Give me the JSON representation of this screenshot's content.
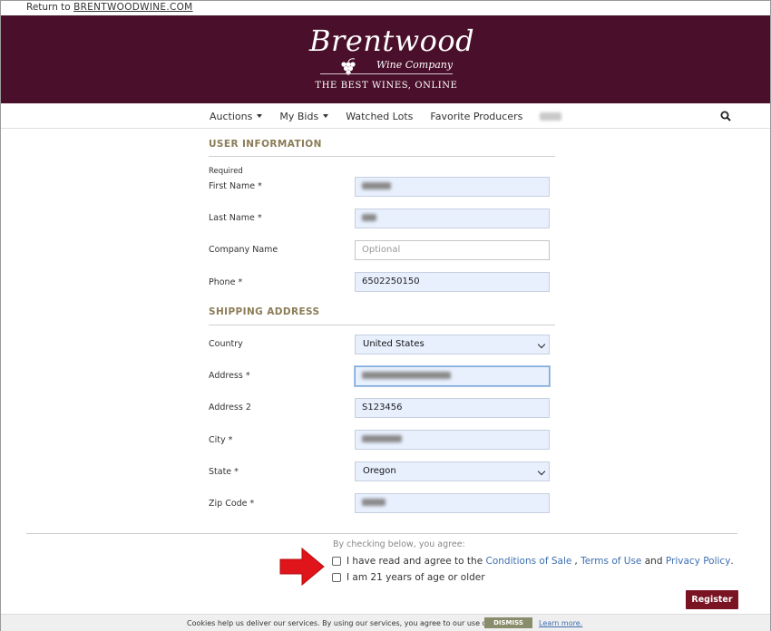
{
  "topbar": {
    "prefix": "Return to",
    "link": "BRENTWOODWINE.COM"
  },
  "logo": {
    "name": "Brentwood",
    "sub": "Wine Company",
    "tagline": "The Best Wines, Online"
  },
  "nav": {
    "items": [
      {
        "label": "Auctions",
        "dropdown": true
      },
      {
        "label": "My Bids",
        "dropdown": true
      },
      {
        "label": "Watched Lots",
        "dropdown": false
      },
      {
        "label": "Favorite Producers",
        "dropdown": false
      }
    ]
  },
  "user_info": {
    "title": "USER INFORMATION",
    "required_note": "Required",
    "first_name_label": "First Name *",
    "last_name_label": "Last Name *",
    "company_label": "Company Name",
    "company_placeholder": "Optional",
    "phone_label": "Phone *",
    "phone_value": "6502250150"
  },
  "shipping": {
    "title": "SHIPPING ADDRESS",
    "country_label": "Country",
    "country_value": "United States",
    "address_label": "Address *",
    "address2_label": "Address 2",
    "address2_value": "S123456",
    "city_label": "City *",
    "state_label": "State *",
    "state_value": "Oregon",
    "zip_label": "Zip Code *"
  },
  "agreement": {
    "intro": "By checking below, you agree:",
    "terms_prefix": "I have read and agree to the",
    "conditions_link": "Conditions of Sale",
    "sep": ",",
    "terms_link": "Terms of Use",
    "and": "and",
    "privacy_link": "Privacy Policy",
    "period": ".",
    "age_label": "I am 21 years of age or older"
  },
  "register_label": "Register",
  "cookie": {
    "text": "Cookies help us deliver our services. By using our services, you agree to our use of cookies.",
    "dismiss": "DISMISS",
    "learn_more": "Learn more."
  },
  "colors": {
    "banner": "#4a0f2a",
    "accent": "#8b7c57",
    "button": "#7a1322",
    "link": "#3d6fb0"
  }
}
